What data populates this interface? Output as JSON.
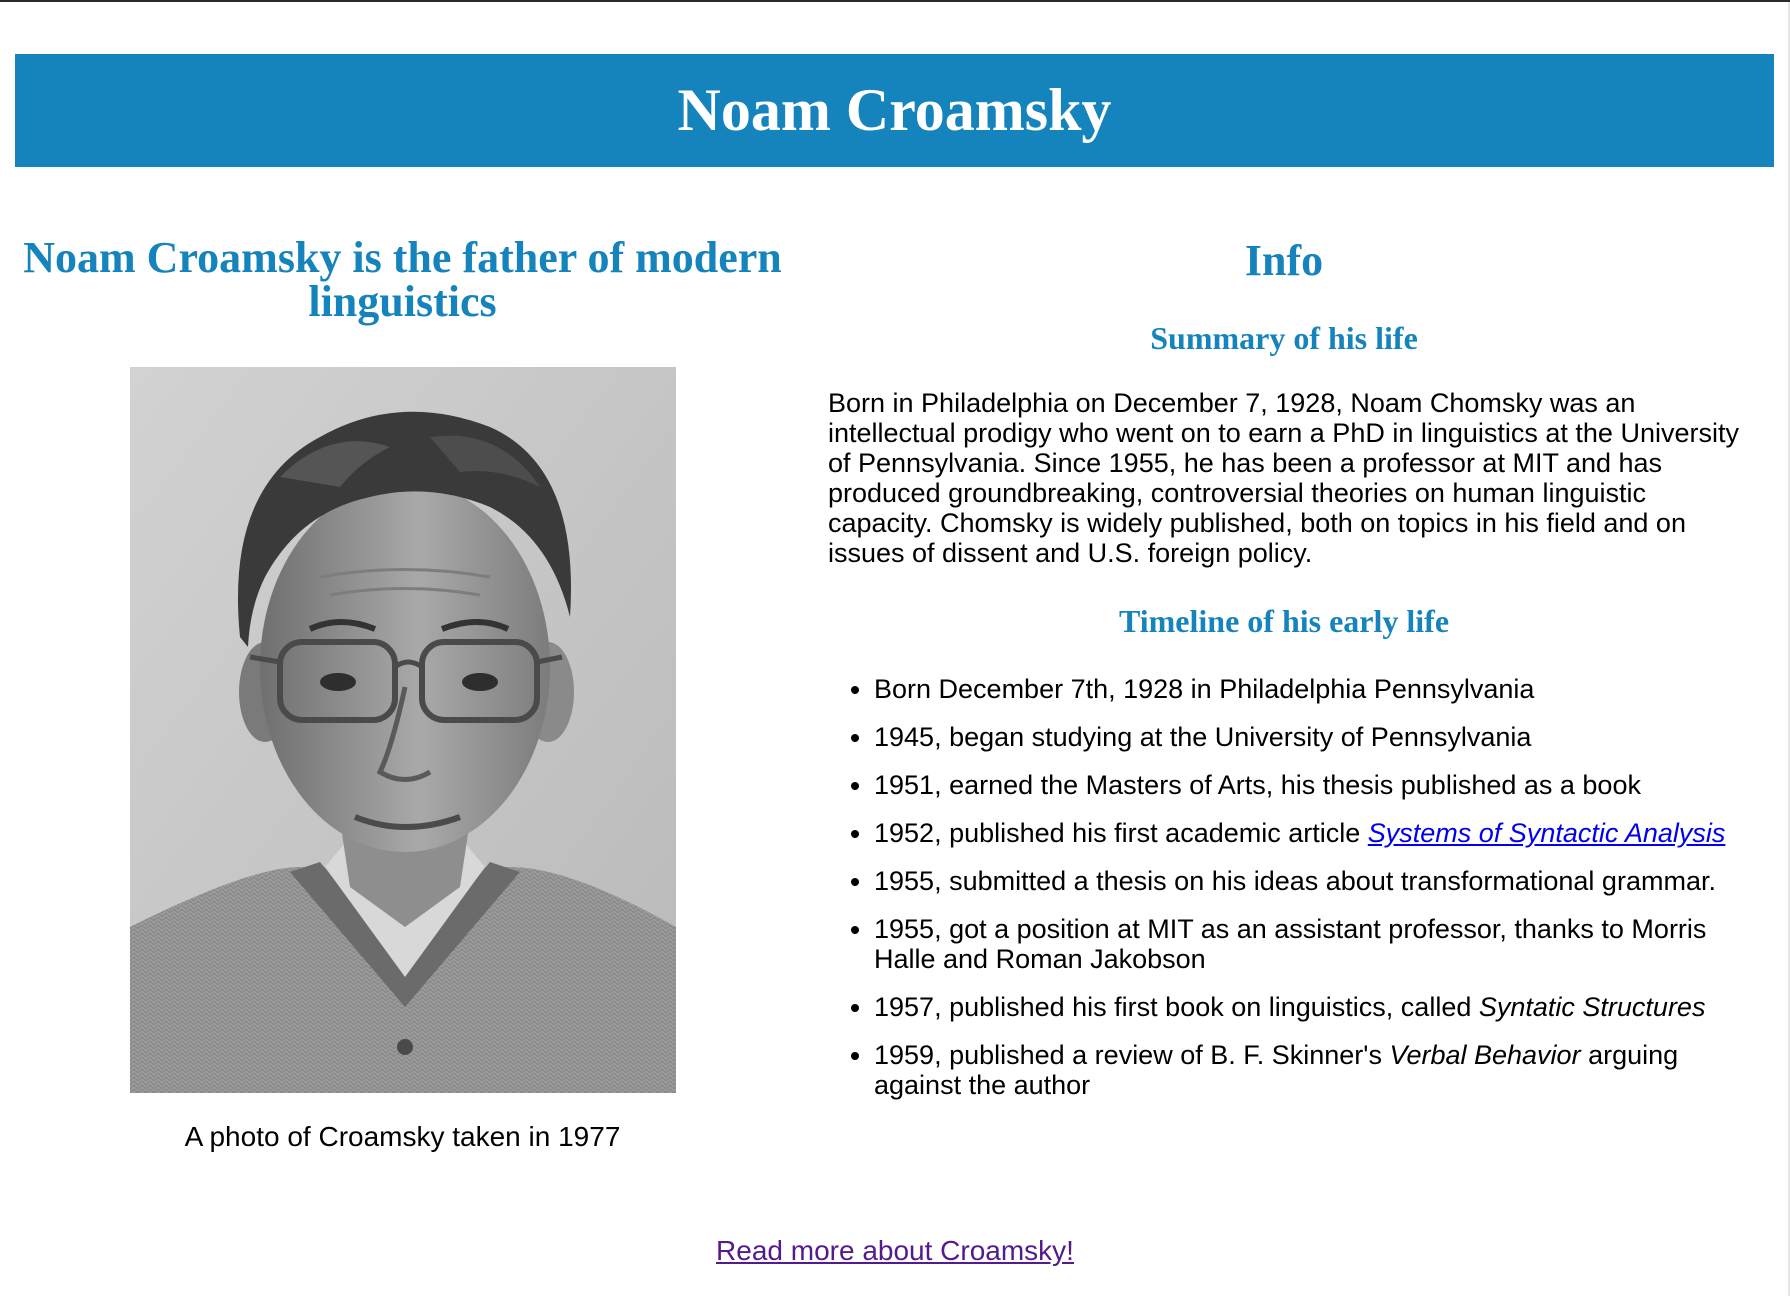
{
  "header": {
    "title": "Noam Croamsky"
  },
  "left_column": {
    "heading": "Noam Croamsky is the father of modern linguistics",
    "photo_caption": "A photo of Croamsky taken in 1977"
  },
  "right_column": {
    "heading": "Info",
    "summary_heading": "Summary of his life",
    "summary_text": "Born in Philadelphia on December 7, 1928, Noam Chomsky was an intellectual prodigy who went on to earn a PhD in linguistics at the University of Pennsylvania. Since 1955, he has been a professor at MIT and has produced groundbreaking, controversial theories on human linguistic capacity. Chomsky is widely published, both on topics in his field and on issues of dissent and U.S. foreign policy.",
    "timeline_heading": "Timeline of his early life",
    "timeline": [
      {
        "text": "Born December 7th, 1928 in Philadelphia Pennsylvania"
      },
      {
        "text": "1945, began studying at the University of Pennsylvania"
      },
      {
        "text": "1951, earned the Masters of Arts, his thesis published as a book"
      },
      {
        "text": "1952, published his first academic article ",
        "link": "Systems of Syntactic Analysis"
      },
      {
        "text": "1955, submitted a thesis on his ideas about transformational grammar."
      },
      {
        "text": "1955, got a position at MIT as an assistant professor, thanks to Morris Halle and Roman Jakobson"
      },
      {
        "text": "1957, published his first book on linguistics, called ",
        "italic": "Syntatic Structures"
      },
      {
        "text": "1959, published a review of B. F. Skinner's ",
        "italic": "Verbal Behavior",
        "after": " arguing against the author"
      }
    ]
  },
  "footer": {
    "read_more_link": "Read more about Croamsky!"
  },
  "colors": {
    "accent": "#1583bc",
    "link": "#0000ee",
    "visited_link": "#551a8b"
  }
}
